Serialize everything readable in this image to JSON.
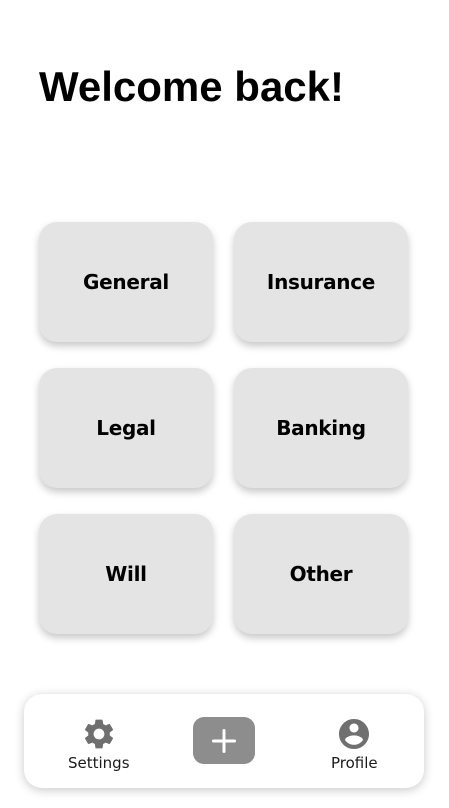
{
  "header": {
    "title": "Welcome back!"
  },
  "categories": [
    {
      "label": "General"
    },
    {
      "label": "Insurance"
    },
    {
      "label": "Legal"
    },
    {
      "label": "Banking"
    },
    {
      "label": "Will"
    },
    {
      "label": "Other"
    }
  ],
  "bottom_nav": {
    "settings_label": "Settings",
    "settings_icon": "gear-icon",
    "add_icon": "plus-icon",
    "profile_label": "Profile",
    "profile_icon": "user-circle-icon"
  },
  "colors": {
    "card_background": "#e4e4e4",
    "add_button": "#8d8d8d",
    "icon": "#6f6f6f"
  }
}
